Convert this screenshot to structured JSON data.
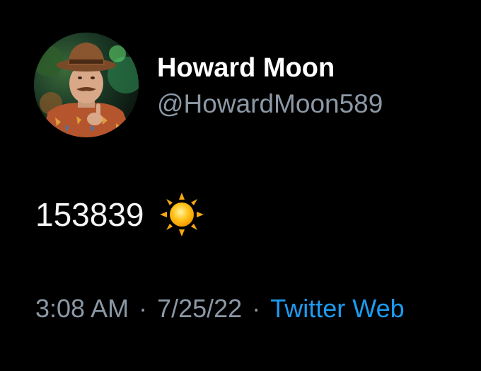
{
  "tweet": {
    "author": {
      "display_name": "Howard Moon",
      "handle": "@HowardMoon589"
    },
    "text": "153839",
    "emoji_icon": "sun-icon",
    "time": "3:08 AM",
    "separator": "·",
    "date": "7/25/22",
    "source": "Twitter Web",
    "colors": {
      "background": "#000000",
      "name": "#ffffff",
      "secondary": "#8b98a5",
      "link": "#1d9bf0"
    }
  }
}
